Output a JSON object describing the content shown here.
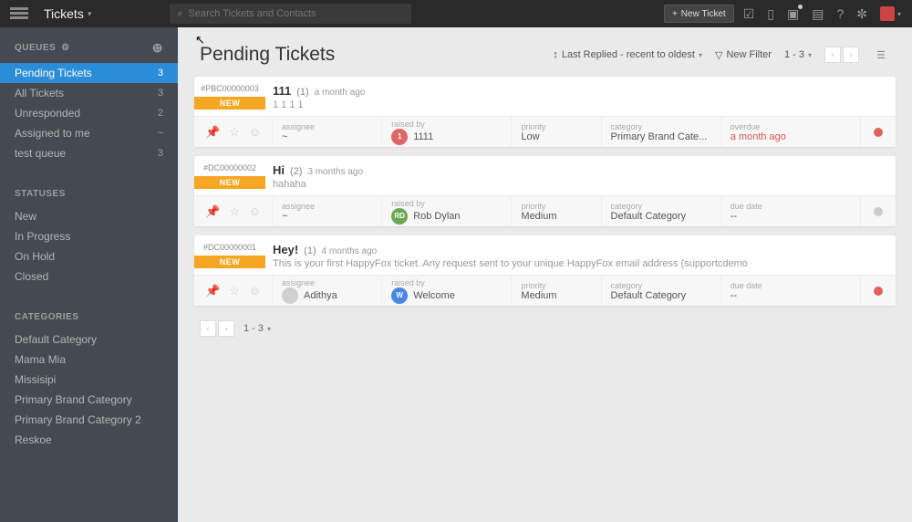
{
  "topbar": {
    "title": "Tickets",
    "search_placeholder": "Search Tickets and Contacts",
    "new_ticket": "New Ticket"
  },
  "sidebar": {
    "queues_heading": "QUEUES",
    "queues": [
      {
        "label": "Pending Tickets",
        "count": "3",
        "active": true
      },
      {
        "label": "All Tickets",
        "count": "3"
      },
      {
        "label": "Unresponded",
        "count": "2"
      },
      {
        "label": "Assigned to me",
        "count": "~"
      },
      {
        "label": "test queue",
        "count": "3"
      }
    ],
    "statuses_heading": "STATUSES",
    "statuses": [
      {
        "label": "New"
      },
      {
        "label": "In Progress"
      },
      {
        "label": "On Hold"
      },
      {
        "label": "Closed"
      }
    ],
    "categories_heading": "CATEGORIES",
    "categories": [
      {
        "label": "Default Category"
      },
      {
        "label": "Mama Mia"
      },
      {
        "label": "Missisipi"
      },
      {
        "label": "Primary Brand Category"
      },
      {
        "label": "Primary Brand Category 2"
      },
      {
        "label": "Reskoe"
      }
    ]
  },
  "main": {
    "title": "Pending Tickets",
    "sort_label": "Last Replied - recent to oldest",
    "filter_label": "New Filter",
    "page_range": "1 - 3",
    "fields": {
      "assignee": "assignee",
      "raised_by": "raised by",
      "priority": "priority",
      "category": "category",
      "overdue": "overdue",
      "due_date": "due date"
    }
  },
  "tickets": [
    {
      "id": "#PBC00000003",
      "status": "NEW",
      "subject": "111",
      "count": "(1)",
      "time": "a month ago",
      "preview": "1 1 1 1",
      "assignee": "~",
      "raised_by": "1111",
      "raised_avatar_class": "red",
      "raised_initials": "1",
      "priority": "Low",
      "category": "Primary Brand Cate...",
      "due_label_key": "overdue",
      "due_value": "a month ago",
      "due_overdue": true,
      "dot": "red"
    },
    {
      "id": "#DC00000002",
      "status": "NEW",
      "subject": "Hi",
      "count": "(2)",
      "time": "3 months ago",
      "preview": "hahaha",
      "assignee": "~",
      "raised_by": "Rob Dylan",
      "raised_avatar_class": "green",
      "raised_initials": "RD",
      "priority": "Medium",
      "category": "Default Category",
      "due_label_key": "due_date",
      "due_value": "--",
      "due_overdue": false,
      "dot": "grey"
    },
    {
      "id": "#DC00000001",
      "status": "NEW",
      "subject": "Hey!",
      "count": "(1)",
      "time": "4 months ago",
      "preview": "This is your first HappyFox ticket. Any request sent to your unique HappyFox email address (supportcdemo",
      "assignee": "Adithya",
      "assignee_avatar_class": "grey",
      "raised_by": "Welcome",
      "raised_avatar_class": "blue",
      "raised_initials": "W",
      "priority": "Medium",
      "category": "Default Category",
      "due_label_key": "due_date",
      "due_value": "--",
      "due_overdue": false,
      "dot": "red"
    }
  ]
}
